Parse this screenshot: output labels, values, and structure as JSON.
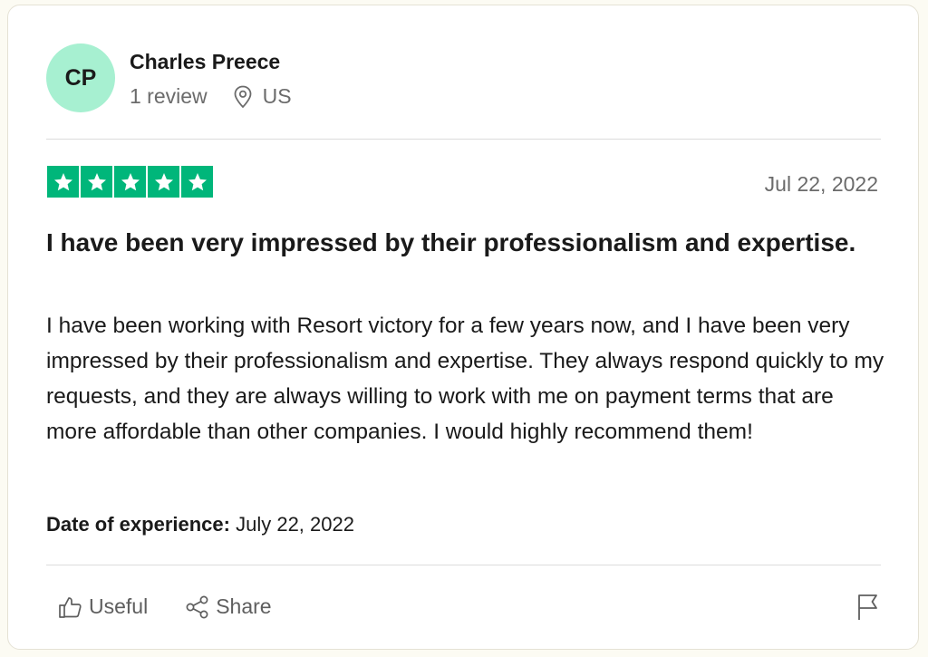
{
  "reviewer": {
    "initials": "CP",
    "name": "Charles Preece",
    "review_count": "1 review",
    "country": "US"
  },
  "review": {
    "rating": 5,
    "date": "Jul 22, 2022",
    "title": "I have been very impressed by their professionalism and expertise.",
    "body": "I have been working with Resort victory for a few years now, and I have been very impressed by their professionalism and expertise. They always respond quickly to my requests, and they are always willing to work with me on payment terms that are more affordable than other companies. I would highly recommend them!",
    "experience_label": "Date of experience:",
    "experience_date": "July 22, 2022"
  },
  "actions": {
    "useful_label": "Useful",
    "share_label": "Share"
  },
  "colors": {
    "star_green": "#00b67a",
    "avatar_bg": "#a7f0d1"
  },
  "icons": [
    "star-icon",
    "location-pin-icon",
    "thumbs-up-icon",
    "share-icon",
    "flag-icon"
  ]
}
